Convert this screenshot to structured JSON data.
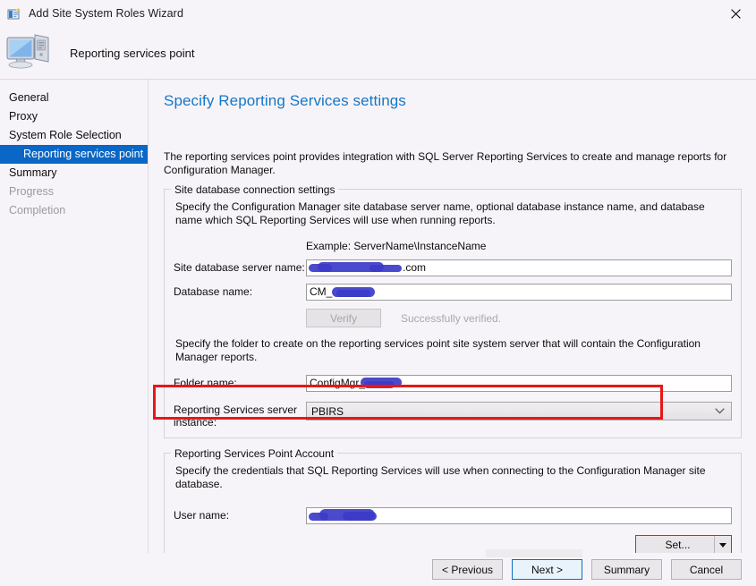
{
  "window": {
    "title": "Add Site System Roles Wizard",
    "icon": "wizard-icon",
    "close_label": "✕"
  },
  "banner": {
    "icon": "computer-icon",
    "title": "Reporting services point"
  },
  "sidebar": {
    "items": [
      {
        "label": "General",
        "state": "normal",
        "indented": false
      },
      {
        "label": "Proxy",
        "state": "normal",
        "indented": false
      },
      {
        "label": "System Role Selection",
        "state": "normal",
        "indented": false
      },
      {
        "label": "Reporting services point",
        "state": "selected",
        "indented": true
      },
      {
        "label": "Summary",
        "state": "normal",
        "indented": false
      },
      {
        "label": "Progress",
        "state": "disabled",
        "indented": false
      },
      {
        "label": "Completion",
        "state": "disabled",
        "indented": false
      }
    ]
  },
  "page": {
    "heading": "Specify Reporting Services settings",
    "intro": "The reporting services point provides integration with SQL Server Reporting Services to create and manage reports for Configuration Manager."
  },
  "db_group": {
    "legend": "Site database connection settings",
    "description": "Specify the Configuration Manager site database server name, optional database instance name, and database name which SQL Reporting Services will use when running reports.",
    "example": "Example: ServerName\\InstanceName",
    "server_label": "Site database server name:",
    "server_value": ".com",
    "server_redacted": true,
    "database_label": "Database name:",
    "database_value": "CM_",
    "database_redacted": true,
    "verify_button": "Verify",
    "verify_status": "Successfully verified.",
    "folder_description": "Specify the folder to create on the reporting services point site system server that will contain the Configuration Manager reports.",
    "folder_label": "Folder name:",
    "folder_value": "ConfigMgr_",
    "folder_redacted": true,
    "instance_label": "Reporting Services server instance:",
    "instance_value": "PBIRS",
    "instance_highlighted": true
  },
  "account_group": {
    "legend": "Reporting Services Point Account",
    "description": "Specify the credentials that SQL Reporting Services will use when connecting to the Configuration Manager site database.",
    "username_label": "User name:",
    "username_value": "",
    "username_redacted": true,
    "set_button": "Set...",
    "set_dropdown_icon": "caret-down-icon"
  },
  "footer": {
    "previous": "< Previous",
    "next": "Next >",
    "summary": "Summary",
    "cancel": "Cancel"
  },
  "colors": {
    "accent_blue": "#0a67c5",
    "heading_blue": "#1577c8",
    "annotation_red": "#e81717",
    "redaction_blue": "#3b3bc8",
    "background": "#f7f4f9"
  }
}
